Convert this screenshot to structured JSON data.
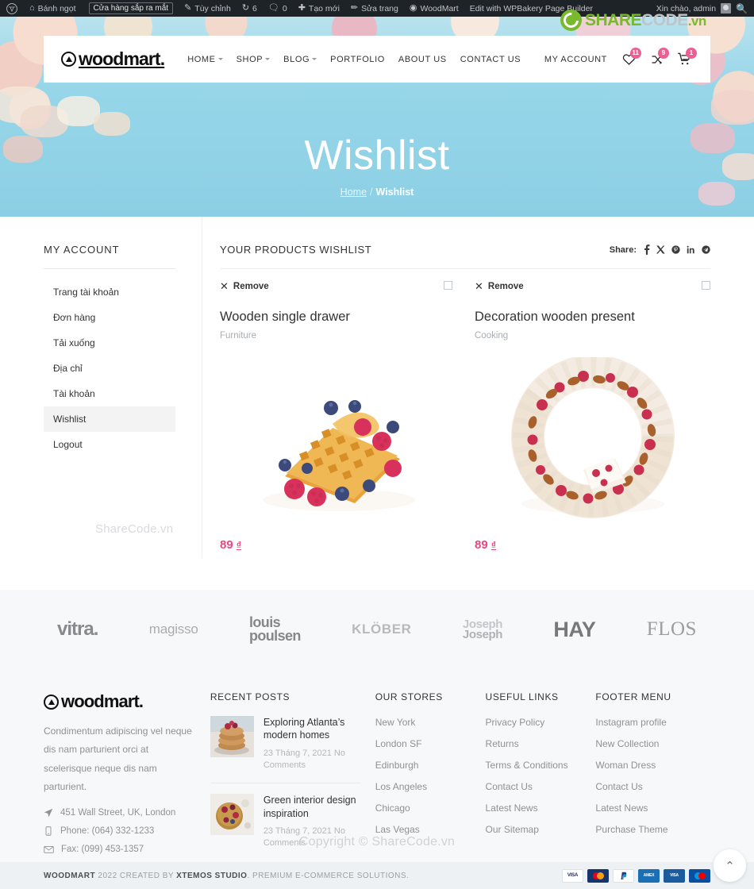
{
  "adminbar": {
    "items": [
      {
        "name": "wp-logo",
        "icon": "wordpress-icon",
        "label": ""
      },
      {
        "name": "site-name",
        "icon": "home-icon",
        "label": "Bánh ngọt"
      },
      {
        "name": "shop-coming-soon",
        "icon": "",
        "label": "Cửa hàng sắp ra mắt"
      },
      {
        "name": "customize",
        "icon": "pencil-icon",
        "label": "Tùy chỉnh"
      },
      {
        "name": "updates",
        "icon": "refresh-icon",
        "label": "6"
      },
      {
        "name": "comments",
        "icon": "comment-icon",
        "label": "0"
      },
      {
        "name": "new-content",
        "icon": "plus-icon",
        "label": "Tạo mới"
      },
      {
        "name": "edit-page",
        "icon": "edit-icon",
        "label": "Sửa trang"
      },
      {
        "name": "woodmart",
        "icon": "woodmart-icon",
        "label": "WoodMart"
      },
      {
        "name": "wpbakery",
        "icon": "",
        "label": "Edit with WPBakery Page Builder"
      }
    ],
    "greeting": "Xin chào, admin"
  },
  "watermark": {
    "top_share": "SHARE",
    "top_code": "CODE",
    "top_vn": ".vn",
    "middle": "ShareCode.vn",
    "bottom": "Copyright © ShareCode.vn"
  },
  "header": {
    "logo": "woodmart.",
    "nav": [
      {
        "label": "HOME",
        "has_dropdown": true
      },
      {
        "label": "SHOP",
        "has_dropdown": true
      },
      {
        "label": "BLOG",
        "has_dropdown": true
      },
      {
        "label": "PORTFOLIO",
        "has_dropdown": false
      },
      {
        "label": "ABOUT US",
        "has_dropdown": false
      },
      {
        "label": "CONTACT US",
        "has_dropdown": false
      }
    ],
    "my_account": "MY ACCOUNT",
    "wishlist_count": "11",
    "compare_count": "9",
    "cart_count": "1"
  },
  "hero": {
    "title": "Wishlist",
    "breadcrumb_home": "Home",
    "breadcrumb_sep": "/",
    "breadcrumb_current": "Wishlist"
  },
  "sidebar": {
    "title": "MY ACCOUNT",
    "items": [
      {
        "label": "Trang tài khoản",
        "active": false
      },
      {
        "label": "Đơn hàng",
        "active": false
      },
      {
        "label": "Tải xuống",
        "active": false
      },
      {
        "label": "Địa chỉ",
        "active": false
      },
      {
        "label": "Tài khoản",
        "active": false
      },
      {
        "label": "Wishlist",
        "active": true
      },
      {
        "label": "Logout",
        "active": false
      }
    ]
  },
  "wishlist": {
    "title": "YOUR PRODUCTS WISHLIST",
    "share_label": "Share:",
    "share_icons": [
      "facebook-icon",
      "x-twitter-icon",
      "pinterest-icon",
      "linkedin-icon",
      "telegram-icon"
    ],
    "remove_label": "Remove",
    "products": [
      {
        "name": "Wooden single drawer",
        "category": "Furniture",
        "price": "89",
        "currency": "₫",
        "image": "waffle-with-berries"
      },
      {
        "name": "Decoration wooden present",
        "category": "Cooking",
        "price": "89",
        "currency": "₫",
        "image": "cream-berry-cake-ring"
      }
    ]
  },
  "brands": [
    {
      "name": "vitra",
      "text": "vitra."
    },
    {
      "name": "magisso",
      "text": "magisso"
    },
    {
      "name": "louis-poulsen",
      "line1": "louis",
      "line2": "poulsen"
    },
    {
      "name": "klober",
      "text": "KLÖBER"
    },
    {
      "name": "joseph-joseph",
      "line1": "Joseph",
      "line2": "Joseph"
    },
    {
      "name": "hay",
      "text": "HAY"
    },
    {
      "name": "flos",
      "text": "FLOS"
    }
  ],
  "footer": {
    "logo": "woodmart.",
    "about": "Condimentum adipiscing vel neque dis nam parturient orci at scelerisque neque dis nam parturient.",
    "address": "451 Wall Street, UK, London",
    "phone": "Phone: (064) 332-1233",
    "fax": "Fax: (099) 453-1357",
    "recent_posts": {
      "title": "RECENT POSTS",
      "items": [
        {
          "title": "Exploring Atlanta’s modern homes",
          "date": "23 Tháng 7, 2021",
          "comments": "No Comments"
        },
        {
          "title": "Green interior design inspiration",
          "date": "23 Tháng 7, 2021",
          "comments": "No Comments"
        }
      ]
    },
    "our_stores": {
      "title": "OUR STORES",
      "items": [
        "New York",
        "London SF",
        "Edinburgh",
        "Los Angeles",
        "Chicago",
        "Las Vegas"
      ]
    },
    "useful_links": {
      "title": "USEFUL LINKS",
      "items": [
        "Privacy Policy",
        "Returns",
        "Terms & Conditions",
        "Contact Us",
        "Latest News",
        "Our Sitemap"
      ]
    },
    "footer_menu": {
      "title": "FOOTER MENU",
      "items": [
        "Instagram profile",
        "New Collection",
        "Woman Dress",
        "Contact Us",
        "Latest News",
        "Purchase Theme"
      ]
    }
  },
  "copyright": {
    "brand": "WOODMART",
    "mid": " 2022 CREATED BY ",
    "studio": "XTEMOS STUDIO",
    "tail": ". PREMIUM E-COMMERCE SOLUTIONS.",
    "payments": [
      "VISA",
      "MasterCard",
      "PayPal",
      "American Express",
      "VISA Electron",
      "Maestro"
    ]
  },
  "colors": {
    "accent": "#ec5f94",
    "price": "#e8487e",
    "hero_bg": "#8fd4e8",
    "admin_bar": "#1d2327",
    "footer_bg": "#f7f8f9"
  }
}
